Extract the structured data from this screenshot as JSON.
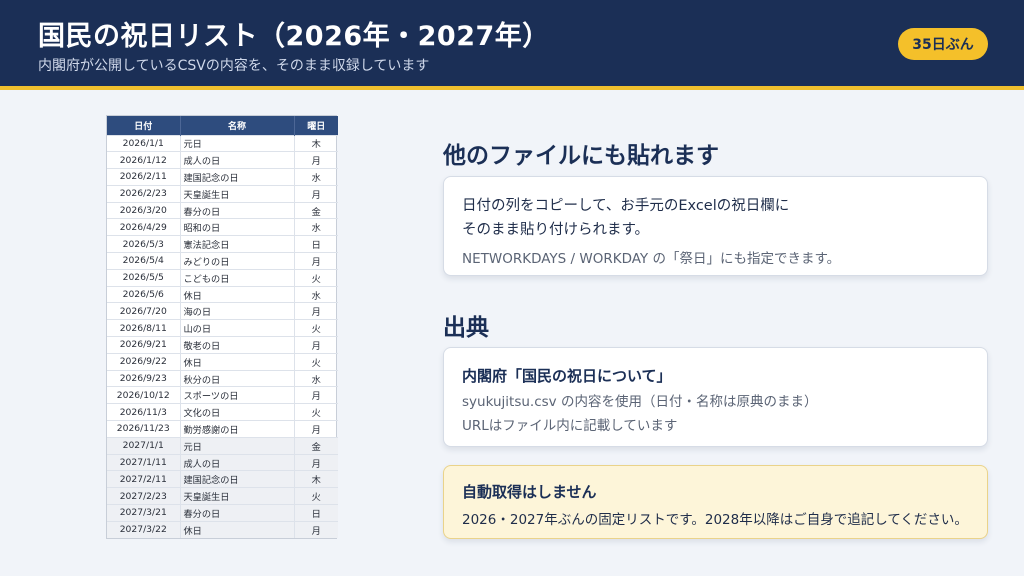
{
  "header": {
    "title": "国民の祝日リスト（2026年・2027年）",
    "subtitle": "内閣府が公開しているCSVの内容を、そのまま収録しています",
    "badge": "35日ぶん"
  },
  "table": {
    "columns": [
      "日付",
      "名称",
      "曜日"
    ],
    "rows": [
      {
        "date": "2026/1/1",
        "name": "元日",
        "weekday": "木",
        "year": "2026"
      },
      {
        "date": "2026/1/12",
        "name": "成人の日",
        "weekday": "月",
        "year": "2026"
      },
      {
        "date": "2026/2/11",
        "name": "建国記念の日",
        "weekday": "水",
        "year": "2026"
      },
      {
        "date": "2026/2/23",
        "name": "天皇誕生日",
        "weekday": "月",
        "year": "2026"
      },
      {
        "date": "2026/3/20",
        "name": "春分の日",
        "weekday": "金",
        "year": "2026"
      },
      {
        "date": "2026/4/29",
        "name": "昭和の日",
        "weekday": "水",
        "year": "2026"
      },
      {
        "date": "2026/5/3",
        "name": "憲法記念日",
        "weekday": "日",
        "year": "2026"
      },
      {
        "date": "2026/5/4",
        "name": "みどりの日",
        "weekday": "月",
        "year": "2026"
      },
      {
        "date": "2026/5/5",
        "name": "こどもの日",
        "weekday": "火",
        "year": "2026"
      },
      {
        "date": "2026/5/6",
        "name": "休日",
        "weekday": "水",
        "year": "2026"
      },
      {
        "date": "2026/7/20",
        "name": "海の日",
        "weekday": "月",
        "year": "2026"
      },
      {
        "date": "2026/8/11",
        "name": "山の日",
        "weekday": "火",
        "year": "2026"
      },
      {
        "date": "2026/9/21",
        "name": "敬老の日",
        "weekday": "月",
        "year": "2026"
      },
      {
        "date": "2026/9/22",
        "name": "休日",
        "weekday": "火",
        "year": "2026"
      },
      {
        "date": "2026/9/23",
        "name": "秋分の日",
        "weekday": "水",
        "year": "2026"
      },
      {
        "date": "2026/10/12",
        "name": "スポーツの日",
        "weekday": "月",
        "year": "2026"
      },
      {
        "date": "2026/11/3",
        "name": "文化の日",
        "weekday": "火",
        "year": "2026"
      },
      {
        "date": "2026/11/23",
        "name": "勤労感謝の日",
        "weekday": "月",
        "year": "2026"
      },
      {
        "date": "2027/1/1",
        "name": "元日",
        "weekday": "金",
        "year": "2027"
      },
      {
        "date": "2027/1/11",
        "name": "成人の日",
        "weekday": "月",
        "year": "2027"
      },
      {
        "date": "2027/2/11",
        "name": "建国記念の日",
        "weekday": "木",
        "year": "2027"
      },
      {
        "date": "2027/2/23",
        "name": "天皇誕生日",
        "weekday": "火",
        "year": "2027"
      },
      {
        "date": "2027/3/21",
        "name": "春分の日",
        "weekday": "日",
        "year": "2027"
      },
      {
        "date": "2027/3/22",
        "name": "休日",
        "weekday": "月",
        "year": "2027"
      }
    ]
  },
  "paste_section": {
    "heading": "他のファイルにも貼れます",
    "line1": "日付の列をコピーして、お手元のExcelの祝日欄に",
    "line2": "そのまま貼り付けられます。",
    "line3": "NETWORKDAYS / WORKDAY の「祭日」にも指定できます。"
  },
  "source_section": {
    "heading": "出典",
    "title": "内閣府「国民の祝日について」",
    "line1": "syukujitsu.csv の内容を使用（日付・名称は原典のまま）",
    "line2": "URLはファイル内に記載しています"
  },
  "note": {
    "title": "自動取得はしません",
    "text": "2026・2027年ぶんの固定リストです。2028年以降はご自身で追記してください。"
  },
  "colors": {
    "header_bg": "#1b2f56",
    "accent_yellow": "#f4c02a",
    "table_header": "#2e4c7e",
    "note_bg": "#fdf5d9"
  }
}
